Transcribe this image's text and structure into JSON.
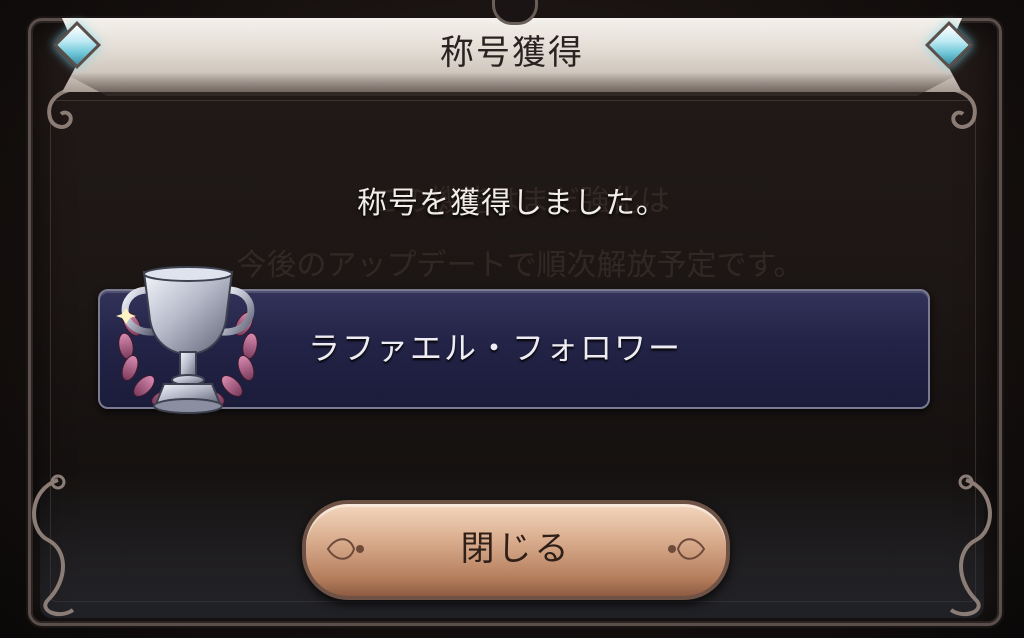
{
  "dialog": {
    "title": "称号獲得",
    "message": "称号を獲得しました。",
    "background_notice": [
      "この機能はまだ強化は",
      "今後のアップデートで順次解放予定です。"
    ],
    "earned_title": "ラファエル・フォロワー",
    "close_label": "閉じる"
  },
  "colors": {
    "banner": "#e4ded6",
    "title_bar": "#232347",
    "close_button": "#d9ac8d",
    "gem_accent": "#6fc7d8",
    "wreath": "#b06a8f",
    "trophy_silver": "#c9ccd6"
  },
  "icons": {
    "trophy": "trophy-icon",
    "gem": "diamond-gem-icon",
    "wreath": "laurel-wreath-icon"
  }
}
